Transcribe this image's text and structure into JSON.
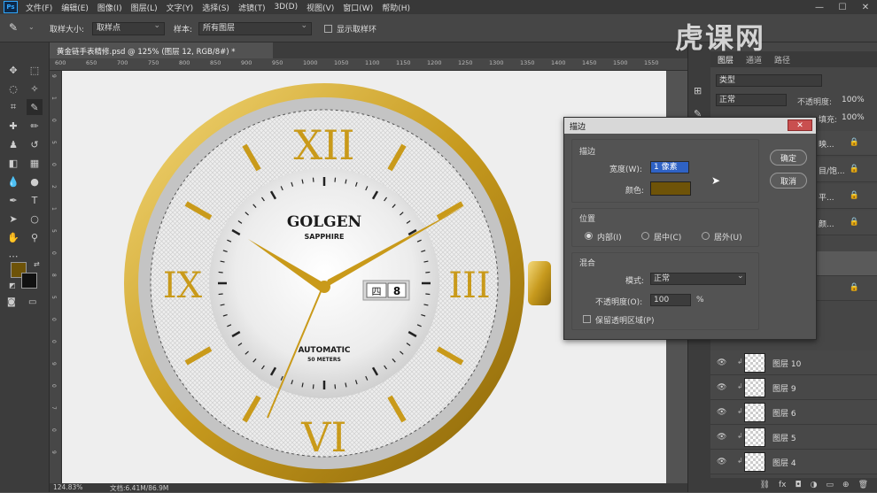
{
  "app": {
    "logo": "Ps"
  },
  "menu": [
    "文件(F)",
    "编辑(E)",
    "图像(I)",
    "图层(L)",
    "文字(Y)",
    "选择(S)",
    "滤镜(T)",
    "3D(D)",
    "视图(V)",
    "窗口(W)",
    "帮助(H)"
  ],
  "window_controls": {
    "minimize": "—",
    "maximize": "☐",
    "close": "✕"
  },
  "options": {
    "sample_size_label": "取样大小:",
    "sample_size_value": "取样点",
    "sample_label": "样本:",
    "sample_value": "所有图层",
    "show_ring_label": "显示取样环"
  },
  "document_tab": "黄金链手表精修.psd @ 125% (图层 12, RGB/8#) *",
  "ruler_top": [
    "600",
    "650",
    "700",
    "750",
    "800",
    "850",
    "900",
    "950",
    "1000",
    "1050",
    "1100",
    "1150",
    "1200",
    "1250",
    "1300",
    "1350",
    "1400",
    "1450",
    "1500",
    "1550"
  ],
  "ruler_left": [
    "9",
    "1",
    "0",
    "5",
    "0",
    "2",
    "1",
    "5",
    "0",
    "8",
    "5",
    "0",
    "0",
    "9",
    "0",
    "7",
    "0",
    "9"
  ],
  "status": {
    "zoom": "124.83%",
    "doc": "文档:6.41M/86.9M"
  },
  "watch": {
    "brand": "GOLGEN",
    "sub": "SAPPHIRE",
    "auto": "AUTOMATIC",
    "meters": "50 METERS",
    "day": "四",
    "date": "8"
  },
  "watch_numerals": [
    "XII",
    "III",
    "VI",
    "IX"
  ],
  "panel": {
    "tabs": [
      "图层",
      "通道",
      "路径"
    ],
    "search_placeholder": "类型",
    "blend_mode": "正常",
    "opacity_label": "不透明度:",
    "opacity_value": "100%",
    "fill_label": "填充:",
    "fill_value": "100%",
    "partial_names": [
      "映...",
      "目/饱...",
      "平...",
      "颜..."
    ],
    "layers": [
      "图层 10",
      "图层 9",
      "图层 6",
      "图层 5",
      "图层 4"
    ]
  },
  "dialog": {
    "title": "描边",
    "close": "✕",
    "stroke_group": "描边",
    "width_label": "宽度(W):",
    "width_value": "1 像素",
    "color_label": "颜色:",
    "position_group": "位置",
    "inside": "内部(I)",
    "center": "居中(C)",
    "outside": "居外(U)",
    "blend_group": "混合",
    "mode_label": "模式:",
    "mode_value": "正常",
    "opacity_label": "不透明度(O):",
    "opacity_value": "100",
    "opacity_unit": "%",
    "preserve_label": "保留透明区域(P)",
    "ok": "确定",
    "cancel": "取消",
    "stroke_color": "#6e5308"
  },
  "watermark": "虎课网",
  "colors": {
    "foreground": "#6e5308",
    "background": "#111111",
    "accent_gold": "#c9a227"
  }
}
